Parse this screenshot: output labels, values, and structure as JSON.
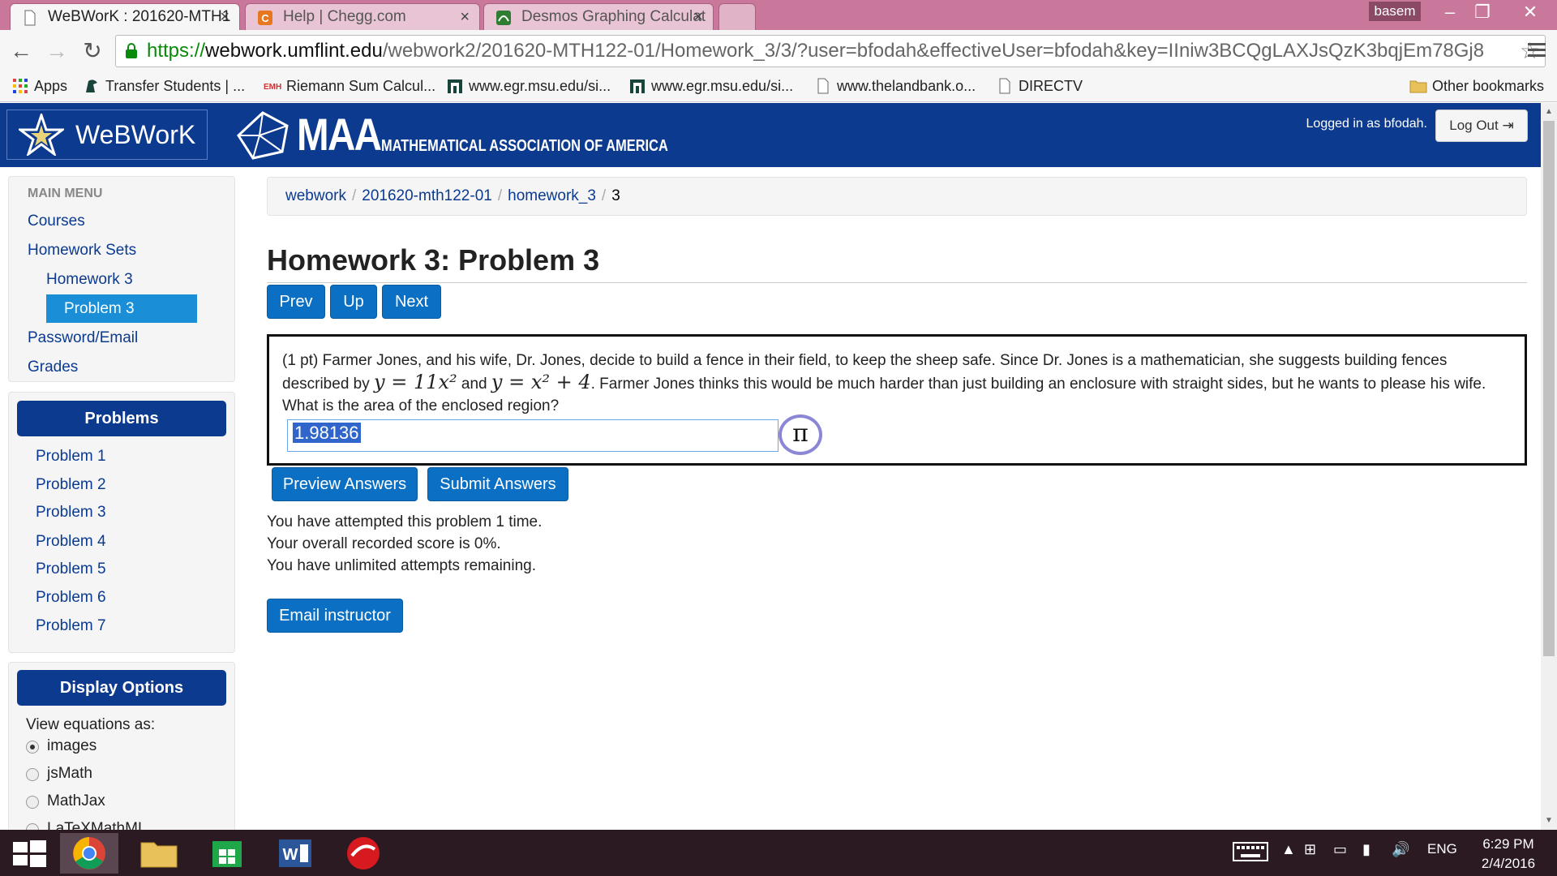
{
  "browser": {
    "tabs": [
      {
        "title": "WeBWorK : 201620-MTH1",
        "active": true
      },
      {
        "title": "Help | Chegg.com",
        "active": false
      },
      {
        "title": "Desmos Graphing Calculat",
        "active": false
      }
    ],
    "profile_name": "basem",
    "url": {
      "scheme": "https://",
      "host": "webwork.umflint.edu",
      "path": "/webwork2/201620-MTH122-01/Homework_3/3/?user=bfodah&effectiveUser=bfodah&key=IIniw3BCQgLAXJsQzK3bqjEm78Gj8"
    },
    "bookmarks": [
      {
        "label": "Apps",
        "icon": "apps-grid-icon"
      },
      {
        "label": "Transfer Students | ...",
        "icon": "spartan-icon"
      },
      {
        "label": "Riemann Sum Calcul...",
        "icon": "emathhelp-icon"
      },
      {
        "label": "www.egr.msu.edu/si...",
        "icon": "msu-building-icon"
      },
      {
        "label": "www.egr.msu.edu/si...",
        "icon": "msu-building-icon"
      },
      {
        "label": "www.thelandbank.o...",
        "icon": "page-icon"
      },
      {
        "label": "DIRECTV",
        "icon": "page-icon"
      }
    ],
    "other_bookmarks": "Other bookmarks"
  },
  "header": {
    "app_name": "WeBWorK",
    "maa_short": "MAA",
    "maa_full": "MATHEMATICAL ASSOCIATION OF AMERICA",
    "logged_in": "Logged in as bfodah.",
    "logout": "Log Out"
  },
  "sidebar": {
    "main_menu_title": "MAIN MENU",
    "courses": "Courses",
    "homework_sets": "Homework Sets",
    "homework_3": "Homework 3",
    "problem_3": "Problem 3",
    "password_email": "Password/Email",
    "grades": "Grades",
    "problems_title": "Problems",
    "problems": [
      "Problem 1",
      "Problem 2",
      "Problem 3",
      "Problem 4",
      "Problem 5",
      "Problem 6",
      "Problem 7"
    ],
    "display_title": "Display Options",
    "view_label": "View equations as:",
    "view_options": [
      "images",
      "jsMath",
      "MathJax",
      "LaTeXMathML"
    ],
    "view_selected": "images"
  },
  "breadcrumb": {
    "items": [
      "webwork",
      "201620-mth122-01",
      "homework_3"
    ],
    "current": "3"
  },
  "page": {
    "title": "Homework 3: Problem 3",
    "nav": {
      "prev": "Prev",
      "up": "Up",
      "next": "Next"
    },
    "problem": {
      "text_a": "(1 pt) Farmer Jones, and his wife, Dr. Jones, decide to build a fence in their field, to keep the sheep safe. Since Dr. Jones is a mathematician, she suggests building fences described by ",
      "eq1": "y = 11x²",
      "text_b": " and ",
      "eq2": "y = x² + 4",
      "text_c": ". Farmer Jones thinks this would be much harder than just building an enclosure with straight sides, but he wants to please his wife. What is the area of the enclosed region?",
      "answer": "1.98136",
      "pi_symbol": "π"
    },
    "preview": "Preview Answers",
    "submit": "Submit Answers",
    "attempts": "You have attempted this problem 1 time.",
    "score": "Your overall recorded score is 0%.",
    "remaining": "You have unlimited attempts remaining.",
    "email": "Email instructor"
  },
  "taskbar": {
    "language": "ENG",
    "time": "6:29 PM",
    "date": "2/4/2016"
  }
}
